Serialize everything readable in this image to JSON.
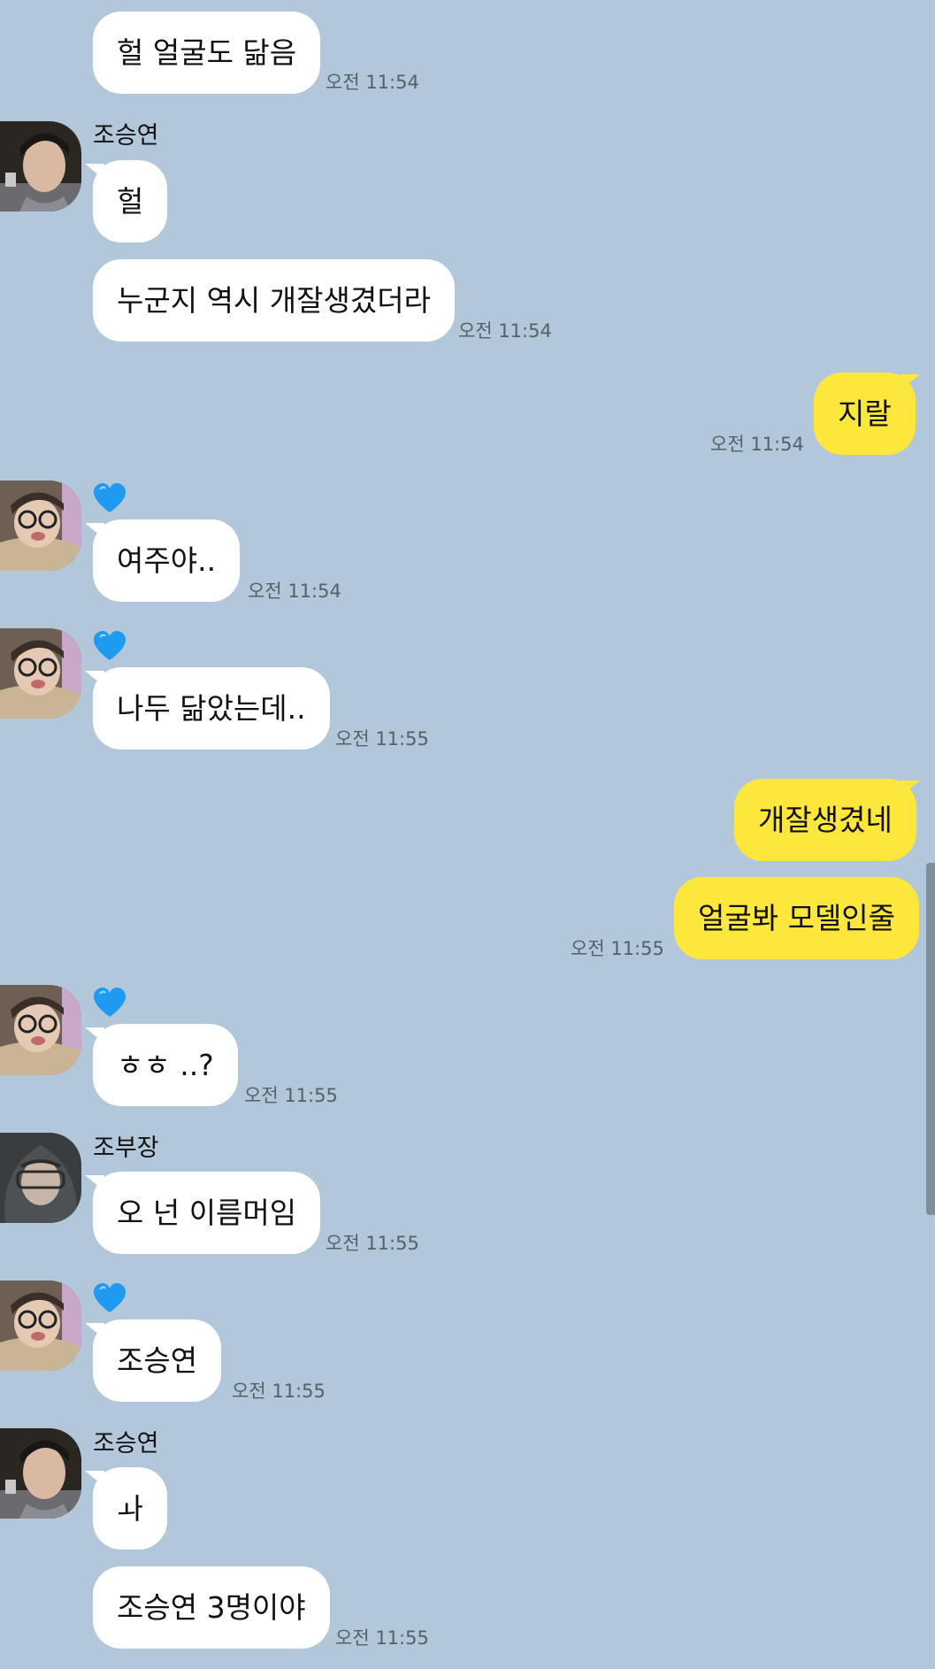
{
  "messages": [
    {
      "side": "in",
      "text": "헐 얼굴도 닮음",
      "time": "오전 11:54"
    },
    {
      "side": "in",
      "sender": "조승연",
      "avatar": "portrait-woman",
      "texts": [
        "헐",
        "누군지 역시 개잘생겼더라"
      ],
      "time": "오전 11:54"
    },
    {
      "side": "out",
      "texts": [
        "지랄"
      ],
      "time": "오전 11:54"
    },
    {
      "side": "in",
      "sender_icon": "blue-heart-icon",
      "avatar": "portrait-glasses",
      "texts": [
        "여주야.."
      ],
      "time": "오전 11:54"
    },
    {
      "side": "in",
      "sender_icon": "blue-heart-icon",
      "avatar": "portrait-glasses",
      "texts": [
        "나두 닮았는데.."
      ],
      "time": "오전 11:55"
    },
    {
      "side": "out",
      "texts": [
        "개잘생겼네",
        "얼굴봐 모델인줄"
      ],
      "time": "오전 11:55"
    },
    {
      "side": "in",
      "sender_icon": "blue-heart-icon",
      "avatar": "portrait-glasses",
      "texts": [
        "ㅎㅎ ..?"
      ],
      "time": "오전 11:55"
    },
    {
      "side": "in",
      "sender": "조부장",
      "avatar": "portrait-hood",
      "texts": [
        "오 넌 이름머임"
      ],
      "time": "오전 11:55"
    },
    {
      "side": "in",
      "sender_icon": "blue-heart-icon",
      "avatar": "portrait-glasses",
      "texts": [
        "조승연"
      ],
      "time": "오전 11:55"
    },
    {
      "side": "in",
      "sender": "조승연",
      "avatar": "portrait-woman",
      "texts": [
        "ㅘ",
        "조승연 3명이야"
      ],
      "time": "오전 11:55"
    }
  ],
  "colors": {
    "background": "#b2c7d9",
    "bubble_in": "#ffffff",
    "bubble_out": "#fee73c",
    "heart": "#1e9bf0"
  }
}
